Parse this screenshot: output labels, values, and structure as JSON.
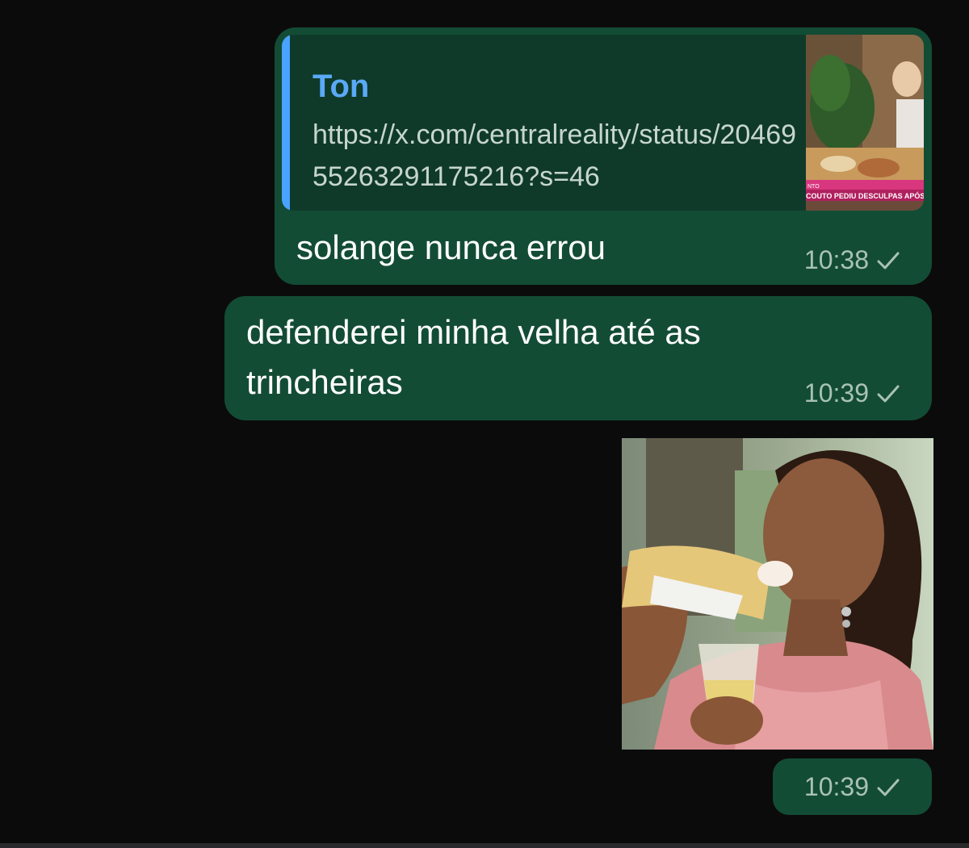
{
  "messages": [
    {
      "quote": {
        "author": "Ton",
        "text": "https://x.com/centralreality/status/2046955263291175216?s=46",
        "thumbnail_caption": "COUTO PEDIU DESCULPAS APÓS FA",
        "thumbnail_small_text": "NTO"
      },
      "text": "solange nunca errou",
      "time": "10:38",
      "status_icon": "check-icon"
    },
    {
      "text": "defenderei minha velha até as trincheiras",
      "time": "10:39",
      "status_icon": "check-icon"
    },
    {
      "type": "image",
      "time": "10:39",
      "status_icon": "check-icon"
    }
  ],
  "colors": {
    "background": "#0b0b0c",
    "bubble_outgoing": "#134c35",
    "quote_bar": "#4aa3ff",
    "quote_author": "#5aa9f7"
  }
}
